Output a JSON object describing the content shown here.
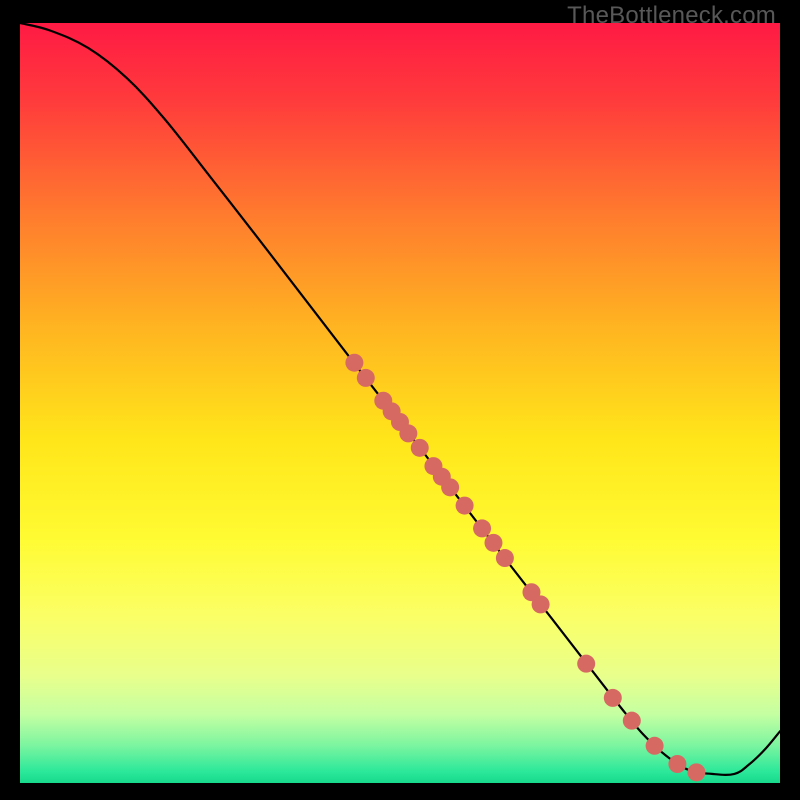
{
  "watermark": "TheBottleneck.com",
  "chart_data": {
    "type": "line",
    "title": "",
    "xlabel": "",
    "ylabel": "",
    "xlim": [
      0,
      100
    ],
    "ylim": [
      0,
      100
    ],
    "background_gradient": {
      "stops": [
        {
          "offset": 0.0,
          "color": "#ff1a44"
        },
        {
          "offset": 0.1,
          "color": "#ff3a3c"
        },
        {
          "offset": 0.25,
          "color": "#ff7a2e"
        },
        {
          "offset": 0.4,
          "color": "#ffb421"
        },
        {
          "offset": 0.55,
          "color": "#ffe61a"
        },
        {
          "offset": 0.68,
          "color": "#fffb33"
        },
        {
          "offset": 0.78,
          "color": "#fbff66"
        },
        {
          "offset": 0.86,
          "color": "#e8ff8c"
        },
        {
          "offset": 0.91,
          "color": "#c4ffa2"
        },
        {
          "offset": 0.95,
          "color": "#7df5a0"
        },
        {
          "offset": 0.985,
          "color": "#2be89a"
        },
        {
          "offset": 1.0,
          "color": "#17d98c"
        }
      ]
    },
    "curve": [
      {
        "x": 0.0,
        "y": 100.0
      },
      {
        "x": 4.0,
        "y": 99.0
      },
      {
        "x": 9.0,
        "y": 96.7
      },
      {
        "x": 14.0,
        "y": 92.8
      },
      {
        "x": 19.0,
        "y": 87.4
      },
      {
        "x": 25.0,
        "y": 79.8
      },
      {
        "x": 31.0,
        "y": 72.1
      },
      {
        "x": 38.0,
        "y": 63.0
      },
      {
        "x": 45.0,
        "y": 53.9
      },
      {
        "x": 52.0,
        "y": 44.9
      },
      {
        "x": 58.0,
        "y": 37.1
      },
      {
        "x": 64.0,
        "y": 29.3
      },
      {
        "x": 70.0,
        "y": 21.6
      },
      {
        "x": 75.5,
        "y": 14.5
      },
      {
        "x": 79.0,
        "y": 10.0
      },
      {
        "x": 82.0,
        "y": 6.4
      },
      {
        "x": 85.0,
        "y": 3.6
      },
      {
        "x": 88.0,
        "y": 1.7
      },
      {
        "x": 91.0,
        "y": 1.2
      },
      {
        "x": 94.0,
        "y": 1.2
      },
      {
        "x": 96.0,
        "y": 2.5
      },
      {
        "x": 98.0,
        "y": 4.4
      },
      {
        "x": 100.0,
        "y": 6.8
      }
    ],
    "points": [
      {
        "x": 44.0,
        "y": 55.3
      },
      {
        "x": 45.5,
        "y": 53.3
      },
      {
        "x": 47.8,
        "y": 50.3
      },
      {
        "x": 48.9,
        "y": 48.9
      },
      {
        "x": 50.0,
        "y": 47.5
      },
      {
        "x": 51.1,
        "y": 46.0
      },
      {
        "x": 52.6,
        "y": 44.1
      },
      {
        "x": 54.4,
        "y": 41.7
      },
      {
        "x": 55.5,
        "y": 40.3
      },
      {
        "x": 56.6,
        "y": 38.9
      },
      {
        "x": 58.5,
        "y": 36.5
      },
      {
        "x": 60.8,
        "y": 33.5
      },
      {
        "x": 62.3,
        "y": 31.6
      },
      {
        "x": 63.8,
        "y": 29.6
      },
      {
        "x": 67.3,
        "y": 25.1
      },
      {
        "x": 68.5,
        "y": 23.5
      },
      {
        "x": 74.5,
        "y": 15.7
      },
      {
        "x": 78.0,
        "y": 11.2
      },
      {
        "x": 80.5,
        "y": 8.2
      },
      {
        "x": 83.5,
        "y": 4.9
      },
      {
        "x": 86.5,
        "y": 2.5
      },
      {
        "x": 89.0,
        "y": 1.4
      }
    ],
    "point_color": "#d66a63",
    "point_radius": 9,
    "curve_color": "#000000",
    "curve_width": 2.2
  }
}
